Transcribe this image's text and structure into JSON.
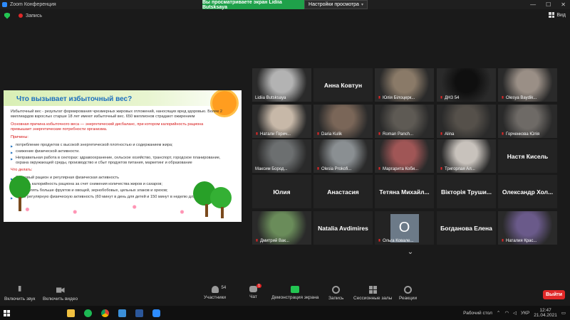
{
  "window": {
    "title": "Zoom Конференция",
    "share_banner": "Вы просматриваете экран Lidiia Butsksaya",
    "view_options": "Настройки просмотра"
  },
  "status": {
    "recording": "Запись",
    "view": "Вид"
  },
  "slide": {
    "heading": "Что вызывает избыточный вес?",
    "para1": "Избыточный вес - результат формирования чрезмерных жировых отложений, наносящих вред здоровью. Более 2 миллиардов взрослых старше 18 лет имеют избыточный вес. 650 миллионов страдают ожирением",
    "para2": "Основная причина избыточного веса — энергетический дисбаланс, при котором калорийность рациона превышает энергетические потребности организма.",
    "causes_title": "Причины:",
    "causes": [
      "потребление продуктов с высокой энергетической плотностью и содержанием жира;",
      "снижение физической активности.",
      "Неправильная работа в секторах: здравоохранение, сельское хозяйство, транспорт, городское планирование, охрана окружающей среды, производство и сбыт продуктов питания, маркетинг и образование"
    ],
    "todo_title": "Что делать:",
    "todo": [
      "Здоровый рацион и регулярная физическая активность",
      "снижать калорийность рациона за счет снижения количества жиров и сахаров;",
      "употреблять больше фруктов и овощей, зернобобовых, цельных злаков и орехов;",
      "вести регулярную физическую активность (60 минут в день для детей и 150 минут в неделю для взрослых"
    ]
  },
  "participants": [
    {
      "name": "Lidiia Butsksaya",
      "kind": "video",
      "muted": false,
      "active": true,
      "color": "#b3b3b3"
    },
    {
      "name": "Анна Ковтун",
      "kind": "name",
      "muted": false
    },
    {
      "name": "Юлія Білоцерк...",
      "kind": "video",
      "muted": true,
      "color": "#8a7a68"
    },
    {
      "name": "ДНЗ 54",
      "kind": "video",
      "muted": true,
      "color": "#0f0f0f"
    },
    {
      "name": "Olesya Baydik...",
      "kind": "video",
      "muted": true,
      "color": "#9a8f86"
    },
    {
      "name": "Натали Горич...",
      "kind": "video",
      "muted": true,
      "color": "#c7b8a8"
    },
    {
      "name": "Daria Kulik",
      "kind": "video",
      "muted": true,
      "color": "#7a6658"
    },
    {
      "name": "Roman Panch...",
      "kind": "video",
      "muted": true,
      "color": "#5e5a54"
    },
    {
      "name": "Alina",
      "kind": "video",
      "muted": true,
      "color": "#55504a"
    },
    {
      "name": "Горченкова Юлія",
      "kind": "video",
      "muted": true,
      "color": "#6e6a66"
    },
    {
      "name": "Максим Бород...",
      "kind": "video",
      "muted": false,
      "color": "#6c6f70"
    },
    {
      "name": "Olesia Prokofi...",
      "kind": "video",
      "muted": true,
      "color": "#8a8f92"
    },
    {
      "name": "Маргарита Коби...",
      "kind": "video",
      "muted": true,
      "color": "#a05656"
    },
    {
      "name": "Тригорлая Ал...",
      "kind": "video",
      "muted": true,
      "color": "#c8c2bc"
    },
    {
      "name": "Настя Кисель",
      "kind": "name",
      "muted": true
    },
    {
      "name": "Юлия",
      "kind": "name",
      "muted": true
    },
    {
      "name": "Анастасия",
      "kind": "name",
      "muted": true
    },
    {
      "name": "Тетяна Михайл...",
      "kind": "name",
      "muted": true
    },
    {
      "name": "Вікторія Труши...",
      "kind": "name",
      "muted": true
    },
    {
      "name": "Олександр Хол...",
      "kind": "name",
      "muted": true
    },
    {
      "name": "Дмитрий Вак...",
      "kind": "video",
      "muted": true,
      "color": "#6a8c5a"
    },
    {
      "name": "Natalia Avdimires",
      "kind": "name",
      "muted": false
    },
    {
      "name": "Ольга Ковале...",
      "kind": "letter",
      "letter": "O",
      "muted": true
    },
    {
      "name": "Богданова Елена",
      "kind": "name",
      "muted": false
    },
    {
      "name": "Наталия Крас...",
      "kind": "video",
      "muted": true,
      "color": "#6a5a8a"
    }
  ],
  "toolbar": {
    "mic": "Включить звук",
    "video": "Включить видео",
    "participants": "Участники",
    "participants_count": "54",
    "chat": "Чат",
    "chat_badge": "1",
    "share": "Демонстрация экрана",
    "record": "Запись",
    "rooms": "Сессионные залы",
    "reactions": "Реакции",
    "leave": "Выйти"
  },
  "taskbar": {
    "desktop": "Рабочий стол",
    "lang": "УКР",
    "time": "12:47",
    "date": "21.04.2021"
  },
  "colors": {
    "share_green": "#1fa14a",
    "leave_red": "#e02828",
    "active_speaker": "#c8e02a",
    "slide_heading": "#1a6fbf"
  }
}
